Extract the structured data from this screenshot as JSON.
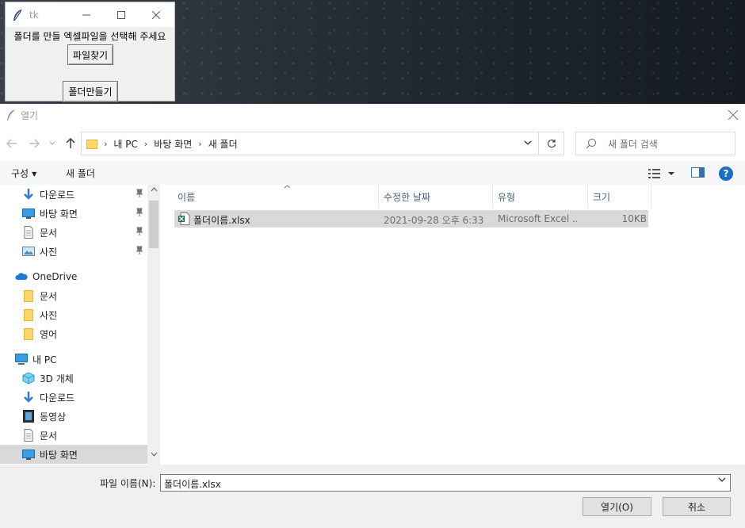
{
  "tk": {
    "title": "tk",
    "prompt": "폴더를 만들 엑셀파일을 선택해 주세요",
    "find_button": "파일찾기",
    "make_button": "폴더만들기"
  },
  "dialog": {
    "title": "열기",
    "breadcrumb": [
      "내 PC",
      "바탕 화면",
      "새 폴더"
    ],
    "search_placeholder": "새 폴더 검색",
    "organize": "구성",
    "new_folder": "새 폴더",
    "sidebar": [
      {
        "label": "다운로드",
        "icon": "download-arrow-icon",
        "pinned": true
      },
      {
        "label": "바탕 화면",
        "icon": "desktop-icon",
        "pinned": true
      },
      {
        "label": "문서",
        "icon": "document-icon",
        "pinned": true
      },
      {
        "label": "사진",
        "icon": "picture-icon",
        "pinned": true
      },
      {
        "label": "OneDrive",
        "icon": "onedrive-cloud-icon"
      },
      {
        "label": "문서",
        "icon": "folder-icon"
      },
      {
        "label": "사진",
        "icon": "folder-icon"
      },
      {
        "label": "영어",
        "icon": "folder-icon"
      },
      {
        "label": "내 PC",
        "icon": "computer-icon"
      },
      {
        "label": "3D 개체",
        "icon": "3d-objects-icon"
      },
      {
        "label": "다운로드",
        "icon": "download-arrow-icon"
      },
      {
        "label": "동영상",
        "icon": "video-icon"
      },
      {
        "label": "문서",
        "icon": "document-icon"
      },
      {
        "label": "바탕 화면",
        "icon": "desktop-icon",
        "selected": true
      }
    ],
    "columns": [
      "이름",
      "수정한 날짜",
      "유형",
      "크기"
    ],
    "files": [
      {
        "name": "폴더이름.xlsx",
        "date": "2021-09-28 오후 6:33",
        "type": "Microsoft Excel ...",
        "size": "10KB",
        "icon": "excel-file-icon"
      }
    ],
    "filename_label": "파일 이름(N):",
    "filename_value": "폴더이름.xlsx",
    "open_button": "열기(O)",
    "cancel_button": "취소"
  },
  "colors": {
    "accent": "#1a6fc4",
    "selection": "#d9d9d9",
    "header_text": "#4c607a",
    "folder": "#ffd766"
  }
}
